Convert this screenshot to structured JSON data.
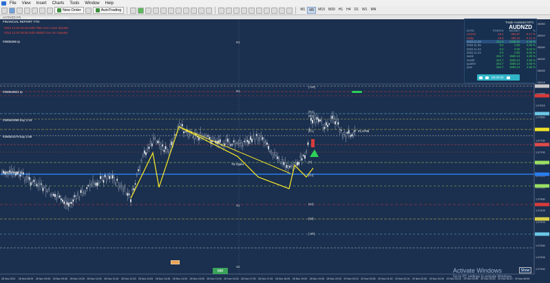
{
  "menu": [
    "File",
    "View",
    "Insert",
    "Charts",
    "Tools",
    "Window",
    "Help"
  ],
  "toolbar": {
    "new_order": "New Order",
    "autotrading": "AutoTrading",
    "timeframes": [
      "M1",
      "M5",
      "M15",
      "M30",
      "H1",
      "H4",
      "D1",
      "W1",
      "MN"
    ],
    "active_tf": "M5"
  },
  "chart_window": {
    "tab": "AUDNZD,M5",
    "ohlc_line": "AUDNZD,M5 1.07948 1.07955 1.07932 1.07942",
    "report": "FINANCIAL REPORT YTD",
    "news1": "2022.12.02 03:45  NZD  RBA Gov Lowe Speaks",
    "news2": "2022.12.02 08:30  NZD  RBNZ Gov Orr Speaks",
    "order_label_top": "#2806286 tp",
    "order_label_red": "#2806286/1 tp",
    "order_label_buy1": "#2806/2986 buy 2.19",
    "order_label_buy2": "#2805/4379 buy 2.96",
    "order_label_left": "#2806/2696 sl",
    "ts_open": "TS Open",
    "ticket_label": "#1.0795",
    "level_labels": [
      "R2",
      "R1",
      "S1",
      "S2"
    ],
    "pivot_labels": [
      "[+2R]",
      "[R3]",
      "[R2]",
      "[R1]",
      "[P]",
      "[S1]",
      "[S2]",
      "[S3]",
      "[-2R]"
    ]
  },
  "price_axis": [
    "1.08360",
    "1.08310",
    "1.08280",
    "1.08160",
    "1.08055",
    "1.08015",
    "1.07966",
    "1.07915",
    "1.07860",
    "1.07805",
    "1.07750",
    "1.07700",
    "1.07645",
    "1.07590",
    "1.07535",
    "1.07480",
    "1.07425",
    "1.07370",
    "1.07315",
    "1.07260",
    "1.07205",
    "1.07150"
  ],
  "time_axis": [
    "28 Nov 2022",
    "28 Nov 08:25",
    "28 Nov 09:05",
    "28 Nov 09:45",
    "28 Nov 10:25",
    "28 Nov 11:05",
    "28 Nov 11:45",
    "28 Nov 12:25",
    "28 Nov 13:05",
    "28 Nov 13:45",
    "28 Nov 14:25",
    "28 Nov 15:05",
    "28 Nov 15:45",
    "28 Nov 16:25",
    "28 Nov 17:05",
    "28 Nov 17:45",
    "28 Nov 18:25",
    "28 Nov 19:05",
    "28 Nov 19:45",
    "28 Nov 20:25",
    "29 Nov 00:10",
    "29 Nov 00:50",
    "29 Nov 01:30",
    "29 Nov 02:10",
    "29 Nov 02:50",
    "29 Nov 03:30",
    "29 Nov 04:10",
    "29 Nov 04:50",
    "29 Nov 05:30",
    "29 Nov 06:10",
    "29 Nov 06:50"
  ],
  "assistant": {
    "title": "Trade Assistant MT4",
    "symbol": "AUDNZD",
    "headers": [
      "DATE",
      "POINTS",
      "MONEY",
      "%"
    ],
    "rows": [
      [
        "current",
        "-18.4",
        "-390.67",
        "-0.17 %"
      ],
      [
        "today",
        "-18.8",
        "-398.10",
        "-0.21 %"
      ],
      [
        "2022.11.28",
        "211.6",
        "4336.81",
        "4.34 %"
      ],
      [
        "2022.11.25",
        "0.0",
        "0.00",
        "0.00 %"
      ],
      [
        "2022.11.24",
        "0.0",
        "0.00",
        "0.00 %"
      ],
      [
        "2022.11.23",
        "0.0",
        "0.00",
        "0.00 %"
      ],
      [
        "week",
        "264.7",
        "4580.14",
        "4.60 %"
      ],
      [
        "month",
        "264.7",
        "4580.14",
        "4.60 %"
      ],
      [
        "quarter",
        "264.7",
        "4580.14",
        "4.60 %"
      ],
      [
        "year",
        "264.7",
        "4580.14",
        "4.60 %"
      ]
    ],
    "timer": "00:00:00"
  },
  "bottom": {
    "mm_button": "MM",
    "watermark": "Activate Windows",
    "watermark_sub": "Go to PC settings to activate Windows.",
    "show_button": "Show"
  }
}
